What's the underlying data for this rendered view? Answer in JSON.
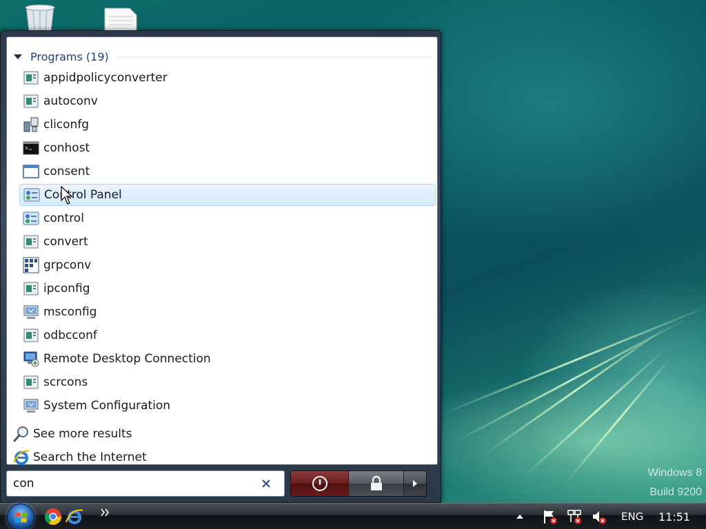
{
  "desktop": {
    "watermark_line1": "Windows 8",
    "watermark_line2": "Build 9200"
  },
  "start_menu": {
    "group_header": "Programs (19)",
    "programs": [
      {
        "label": "appidpolicyconverter",
        "icon": "console-app-icon"
      },
      {
        "label": "autoconv",
        "icon": "console-app-icon"
      },
      {
        "label": "cliconfg",
        "icon": "cliconfg-icon"
      },
      {
        "label": "conhost",
        "icon": "command-prompt-icon"
      },
      {
        "label": "consent",
        "icon": "window-icon"
      },
      {
        "label": "Control Panel",
        "icon": "control-panel-icon",
        "selected": true
      },
      {
        "label": "control",
        "icon": "control-panel-icon"
      },
      {
        "label": "convert",
        "icon": "console-app-icon"
      },
      {
        "label": "grpconv",
        "icon": "grpconv-icon"
      },
      {
        "label": "ipconfig",
        "icon": "console-app-icon"
      },
      {
        "label": "msconfig",
        "icon": "msconfig-icon"
      },
      {
        "label": "odbcconf",
        "icon": "console-app-icon"
      },
      {
        "label": "Remote Desktop Connection",
        "icon": "remote-desktop-icon"
      },
      {
        "label": "scrcons",
        "icon": "console-app-icon"
      },
      {
        "label": "System Configuration",
        "icon": "msconfig-icon"
      }
    ],
    "see_more": "See more results",
    "search_internet": "Search the Internet",
    "search_value": "con"
  },
  "taskbar": {
    "language": "ENG",
    "clock": "11:51"
  }
}
